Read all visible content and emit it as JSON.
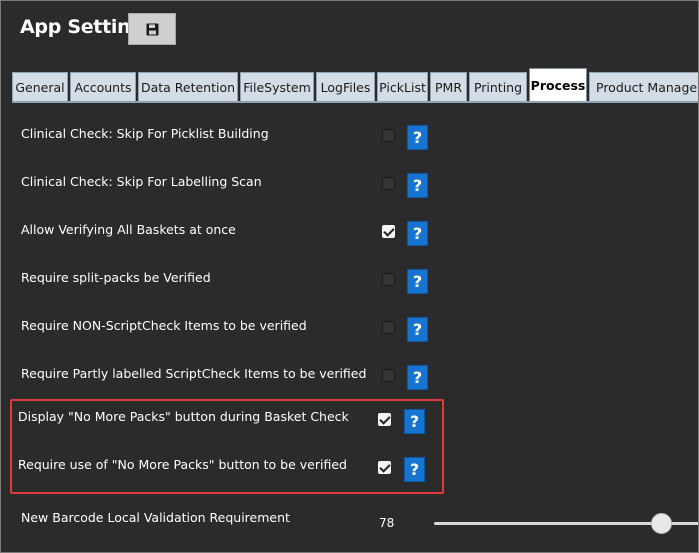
{
  "window": {
    "title": "App Settings"
  },
  "toolbar": {
    "save_icon": "save-icon"
  },
  "tabs": [
    {
      "label": "General"
    },
    {
      "label": "Accounts"
    },
    {
      "label": "Data Retention"
    },
    {
      "label": "FileSystem"
    },
    {
      "label": "LogFiles"
    },
    {
      "label": "PickList"
    },
    {
      "label": "PMR"
    },
    {
      "label": "Printing"
    },
    {
      "label": "Process",
      "active": true
    },
    {
      "label": "Product Manager"
    }
  ],
  "settings": [
    {
      "label": "Clinical Check: Skip For Picklist Building",
      "checked": false,
      "help": "?"
    },
    {
      "label": "Clinical Check: Skip For Labelling Scan",
      "checked": false,
      "help": "?"
    },
    {
      "label": "Allow Verifying All Baskets at once",
      "checked": true,
      "help": "?"
    },
    {
      "label": "Require split-packs be Verified",
      "checked": false,
      "help": "?"
    },
    {
      "label": "Require NON-ScriptCheck Items to be verified",
      "checked": false,
      "help": "?"
    },
    {
      "label": "Require Partly labelled ScriptCheck Items to be verified",
      "checked": false,
      "help": "?"
    },
    {
      "label": "Display \"No More Packs\" button during Basket Check",
      "checked": true,
      "help": "?"
    },
    {
      "label": "Require use of \"No More Packs\" button to be verified",
      "checked": true,
      "help": "?"
    }
  ],
  "slider": {
    "label": "New Barcode Local Validation Requirement",
    "value": "78"
  },
  "colors": {
    "background": "#2b2b2b",
    "help_button": "#1675d1",
    "highlight": "#e03a3a"
  }
}
